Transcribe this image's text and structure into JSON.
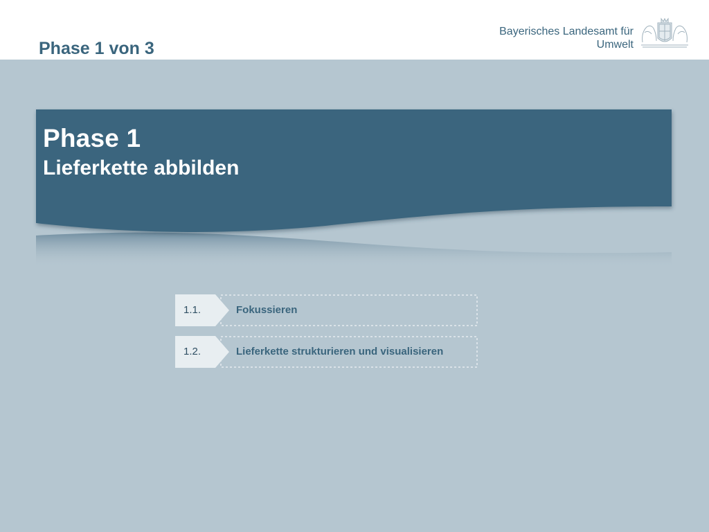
{
  "header": {
    "phase_indicator": "Phase 1 von 3",
    "org_line1": "Bayerisches Landesamt für",
    "org_line2": "Umwelt",
    "logo_icon": "bavarian-coat-of-arms"
  },
  "banner": {
    "title": "Phase 1",
    "subtitle": "Lieferkette abbilden"
  },
  "steps": [
    {
      "number": "1.1.",
      "label": "Fokussieren"
    },
    {
      "number": "1.2.",
      "label": "Lieferkette strukturieren und visualisieren"
    }
  ],
  "colors": {
    "accent": "#3a657d",
    "background": "#b5c6d0",
    "header_background": "#ffffff"
  }
}
